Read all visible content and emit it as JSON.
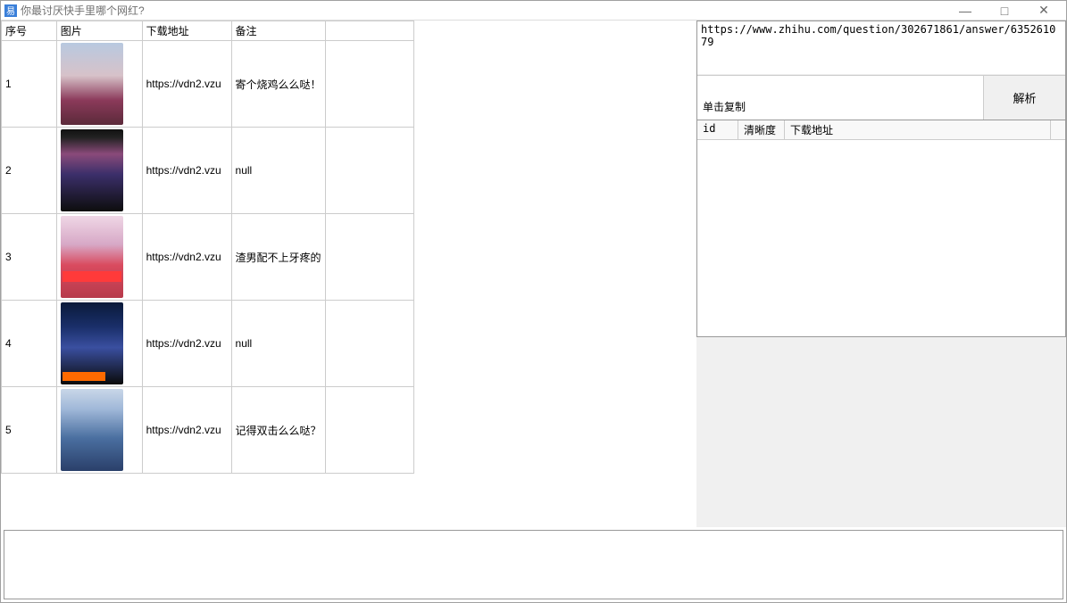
{
  "window": {
    "title": "你最讨厌快手里哪个网红?"
  },
  "controls": {
    "minimize": "—",
    "maximize": "□",
    "close": "✕"
  },
  "main_table": {
    "headers": {
      "index": "序号",
      "image": "图片",
      "url": "下载地址",
      "remark": "备注",
      "extra": ""
    },
    "rows": [
      {
        "index": "1",
        "url": "https://vdn2.vzu",
        "remark": "寄个烧鸡么么哒！"
      },
      {
        "index": "2",
        "url": "https://vdn2.vzu",
        "remark": "null"
      },
      {
        "index": "3",
        "url": "https://vdn2.vzu",
        "remark": "渣男配不上牙疼的"
      },
      {
        "index": "4",
        "url": "https://vdn2.vzu",
        "remark": "null"
      },
      {
        "index": "5",
        "url": "https://vdn2.vzu",
        "remark": "记得双击么么哒？"
      }
    ]
  },
  "right": {
    "url_value": "https://www.zhihu.com/question/302671861/answer/635261079",
    "copy_label": "单击复制",
    "parse_btn": "解析",
    "list_headers": {
      "id": "id",
      "quality": "清晰度",
      "url": "下载地址"
    }
  }
}
